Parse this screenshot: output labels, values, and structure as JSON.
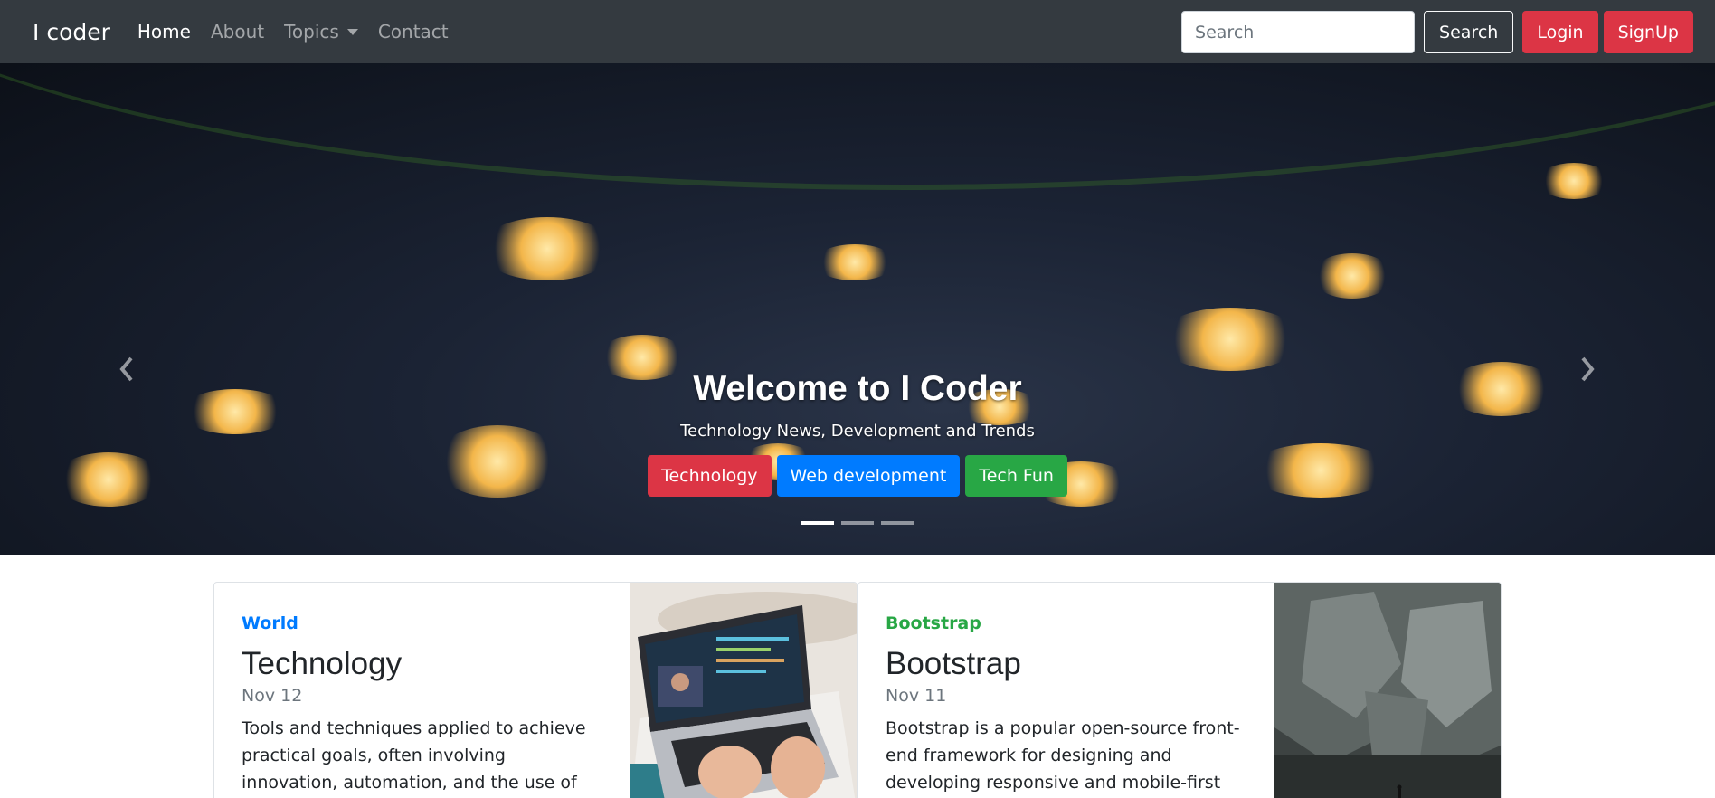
{
  "navbar": {
    "brand": "I coder",
    "links": [
      {
        "label": "Home",
        "active": true
      },
      {
        "label": "About",
        "active": false
      },
      {
        "label": "Topics",
        "active": false,
        "dropdown": true
      },
      {
        "label": "Contact",
        "active": false
      }
    ],
    "search_placeholder": "Search",
    "search_button": "Search",
    "login_button": "Login",
    "signup_button": "SignUp"
  },
  "carousel": {
    "heading": "Welcome to I Coder",
    "subheading": "Technology News, Development and Trends",
    "buttons": [
      {
        "label": "Technology",
        "color": "#dc3545"
      },
      {
        "label": "Web development",
        "color": "#007bff"
      },
      {
        "label": "Tech Fun",
        "color": "#28a745"
      }
    ],
    "slide_count": 3,
    "active_slide": 1,
    "prev_icon": "chevron-left-icon",
    "next_icon": "chevron-right-icon"
  },
  "cards": [
    {
      "category": "World",
      "category_color": "#007bff",
      "title": "Technology",
      "date": "Nov 12",
      "text": "Tools and techniques applied to achieve practical goals, often involving innovation, automation, and the use of"
    },
    {
      "category": "Bootstrap",
      "category_color": "#28a745",
      "title": "Bootstrap",
      "date": "Nov 11",
      "text": "Bootstrap is a popular open-source front-end framework for designing and developing responsive and mobile-first"
    }
  ],
  "colors": {
    "navbar_bg": "#343a40",
    "danger": "#dc3545",
    "primary": "#007bff",
    "success": "#28a745"
  }
}
